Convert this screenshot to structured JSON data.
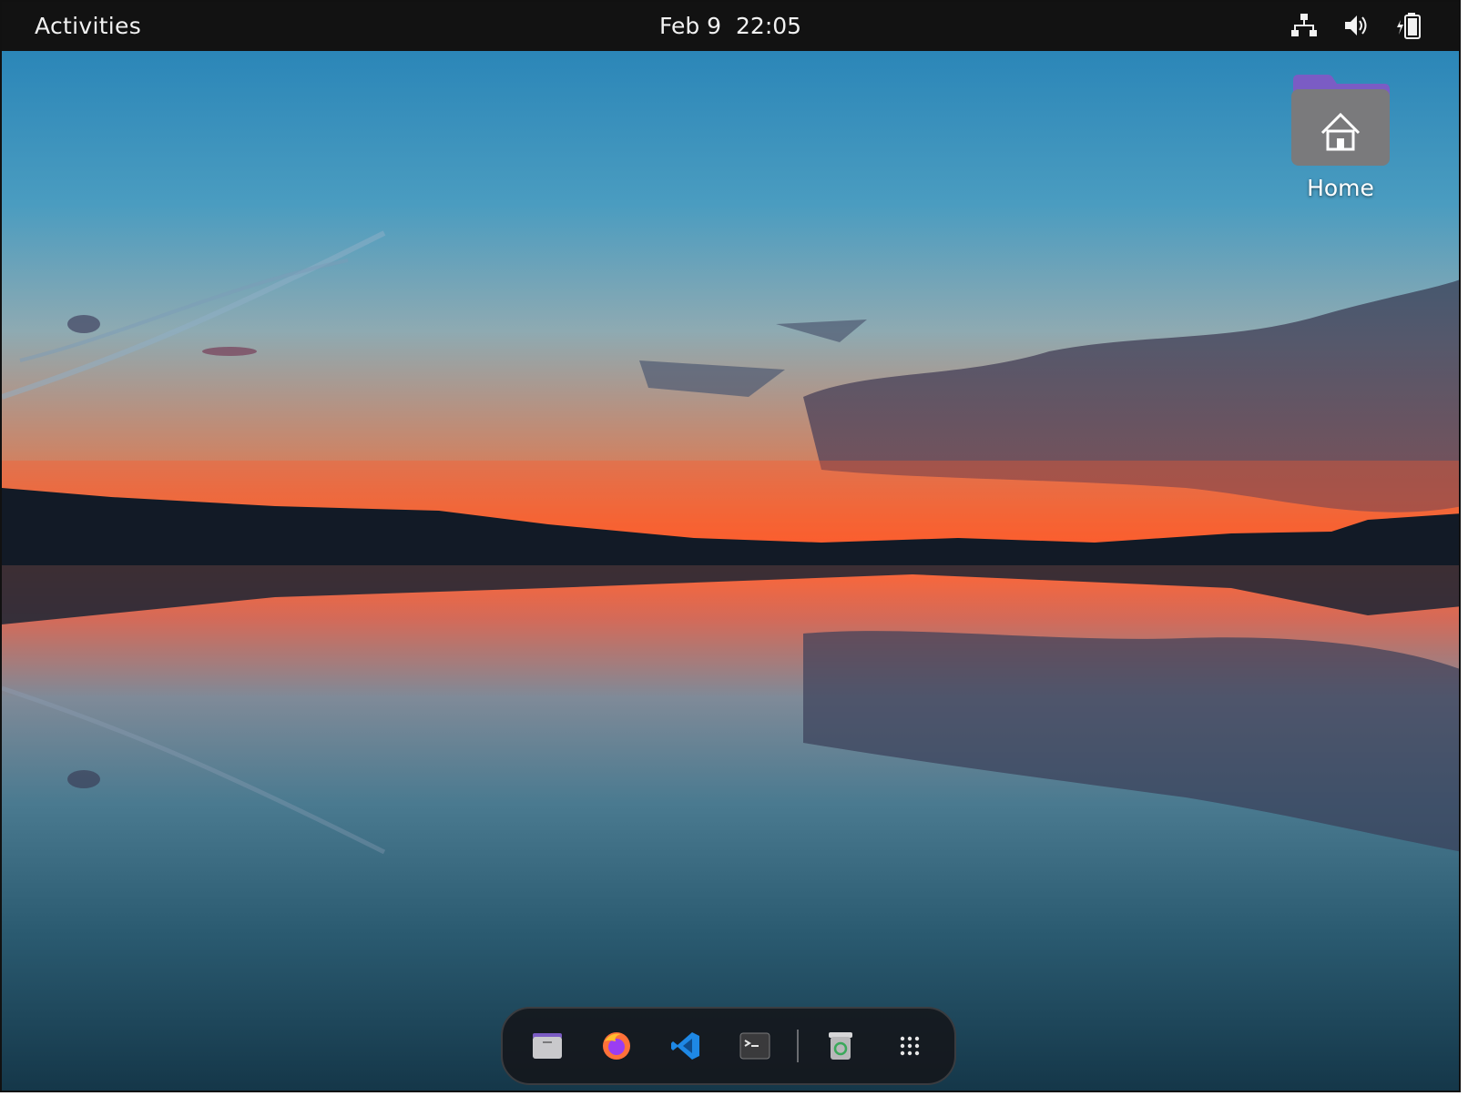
{
  "topbar": {
    "activities_label": "Activities",
    "date": "Feb 9",
    "time": "22:05",
    "tray_icons": [
      "network-icon",
      "volume-icon",
      "battery-icon"
    ]
  },
  "desktop": {
    "icons": [
      {
        "label": "Home",
        "icon": "home-folder-icon"
      }
    ]
  },
  "dock": {
    "items": [
      "files-icon",
      "firefox-icon",
      "vscode-icon",
      "terminal-icon",
      "trash-icon",
      "show-apps-icon"
    ]
  },
  "colors": {
    "topbar_bg": "#121212",
    "folder_top": "#7b5cc4",
    "folder_body": "#7a7a7c",
    "vscode_blue": "#1e88e5",
    "firefox_orange": "#ff7139"
  }
}
